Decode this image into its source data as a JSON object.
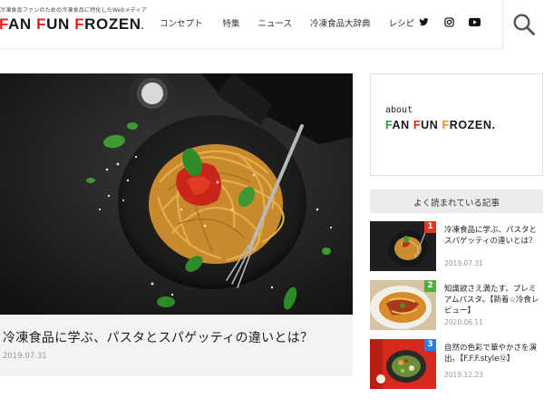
{
  "header": {
    "tagline": "冷凍食品ファンのための冷凍食品に特化したWebメディア",
    "logo_text": "FAN FUN FROZEN.",
    "nav": [
      {
        "label": "コンセプト"
      },
      {
        "label": "特集"
      },
      {
        "label": "ニュース"
      },
      {
        "label": "冷凍食品大辞典"
      },
      {
        "label": "レシピ"
      }
    ],
    "social": [
      "twitter-icon",
      "instagram-icon",
      "youtube-icon"
    ],
    "search_icon": "search-icon"
  },
  "hero": {
    "title": "冷凍食品に学ぶ、パスタとスパゲッティの違いとは？",
    "date": "2019.07.31"
  },
  "sidebar": {
    "about_label": "about",
    "about_logo": "FAN FUN FROZEN.",
    "popular_heading": "よく読まれている記事",
    "ranking": [
      {
        "rank": "1",
        "title": "冷凍食品に学ぶ、パスタとスパゲッティの違いとは？",
        "date": "2019.07.31",
        "badge_color": "#e03a22"
      },
      {
        "rank": "2",
        "title": "知識欲さえ満たす、プレミアムパスタ。【新着☆冷食レビュー】",
        "date": "2020.06.11",
        "badge_color": "#4caf3c"
      },
      {
        "rank": "3",
        "title": "自然の色彩で華やかさを演出。【F.F.F.style⑫】",
        "date": "2019.12.23",
        "badge_color": "#2f7fd6"
      }
    ]
  },
  "colors": {
    "accent_red": "#e0231c",
    "accent_green": "#1f9d3f",
    "accent_orange": "#f08c1a",
    "panel_gray": "#f3f3f3"
  }
}
